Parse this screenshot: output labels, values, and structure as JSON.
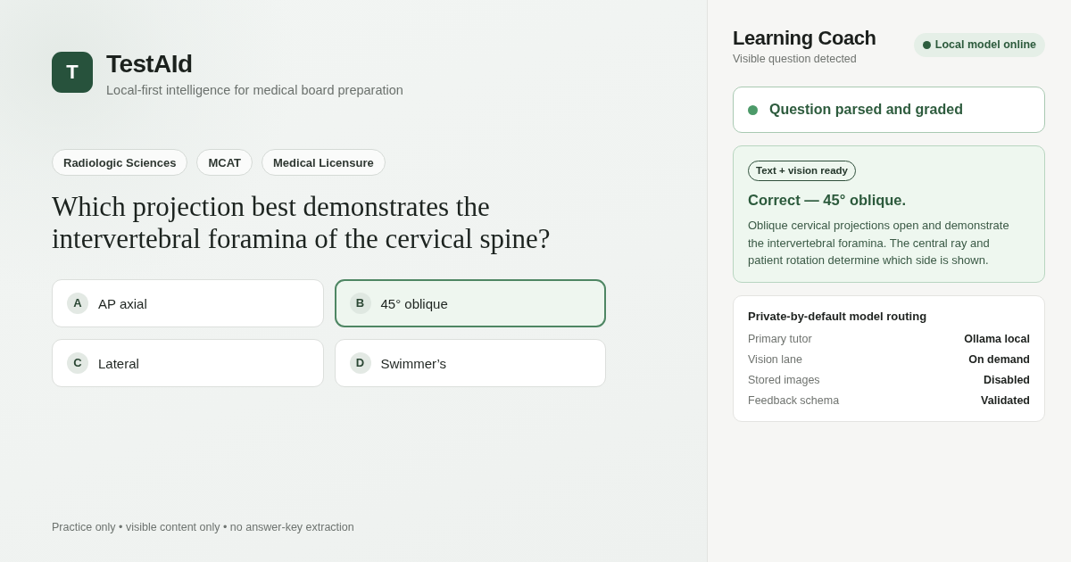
{
  "brand": {
    "logo_letter": "T",
    "name": "TestAId",
    "tagline": "Local-first intelligence for medical board preparation"
  },
  "tags": [
    "Radiologic Sciences",
    "MCAT",
    "Medical Licensure"
  ],
  "question": "Which projection best demonstrates the intervertebral foramina of the cervical spine?",
  "options": [
    {
      "letter": "A",
      "text": "AP axial",
      "selected": false
    },
    {
      "letter": "B",
      "text": "45° oblique",
      "selected": true
    },
    {
      "letter": "C",
      "text": "Lateral",
      "selected": false
    },
    {
      "letter": "D",
      "text": "Swimmer’s",
      "selected": false
    }
  ],
  "footer": "Practice only • visible content only • no answer-key extraction",
  "coach": {
    "title": "Learning Coach",
    "subtitle": "Visible question detected",
    "model_status": "Local model online",
    "parse_status": "Question parsed and graded",
    "feedback": {
      "tag": "Text + vision ready",
      "heading": "Correct — 45° oblique.",
      "body": "Oblique cervical projections open and demonstrate the intervertebral foramina. The central ray and patient rotation determine which side is shown."
    },
    "routing": {
      "title": "Private-by-default model routing",
      "rows": [
        {
          "label": "Primary tutor",
          "value": "Ollama local"
        },
        {
          "label": "Vision lane",
          "value": "On demand"
        },
        {
          "label": "Stored images",
          "value": "Disabled"
        },
        {
          "label": "Feedback schema",
          "value": "Validated"
        }
      ]
    }
  }
}
